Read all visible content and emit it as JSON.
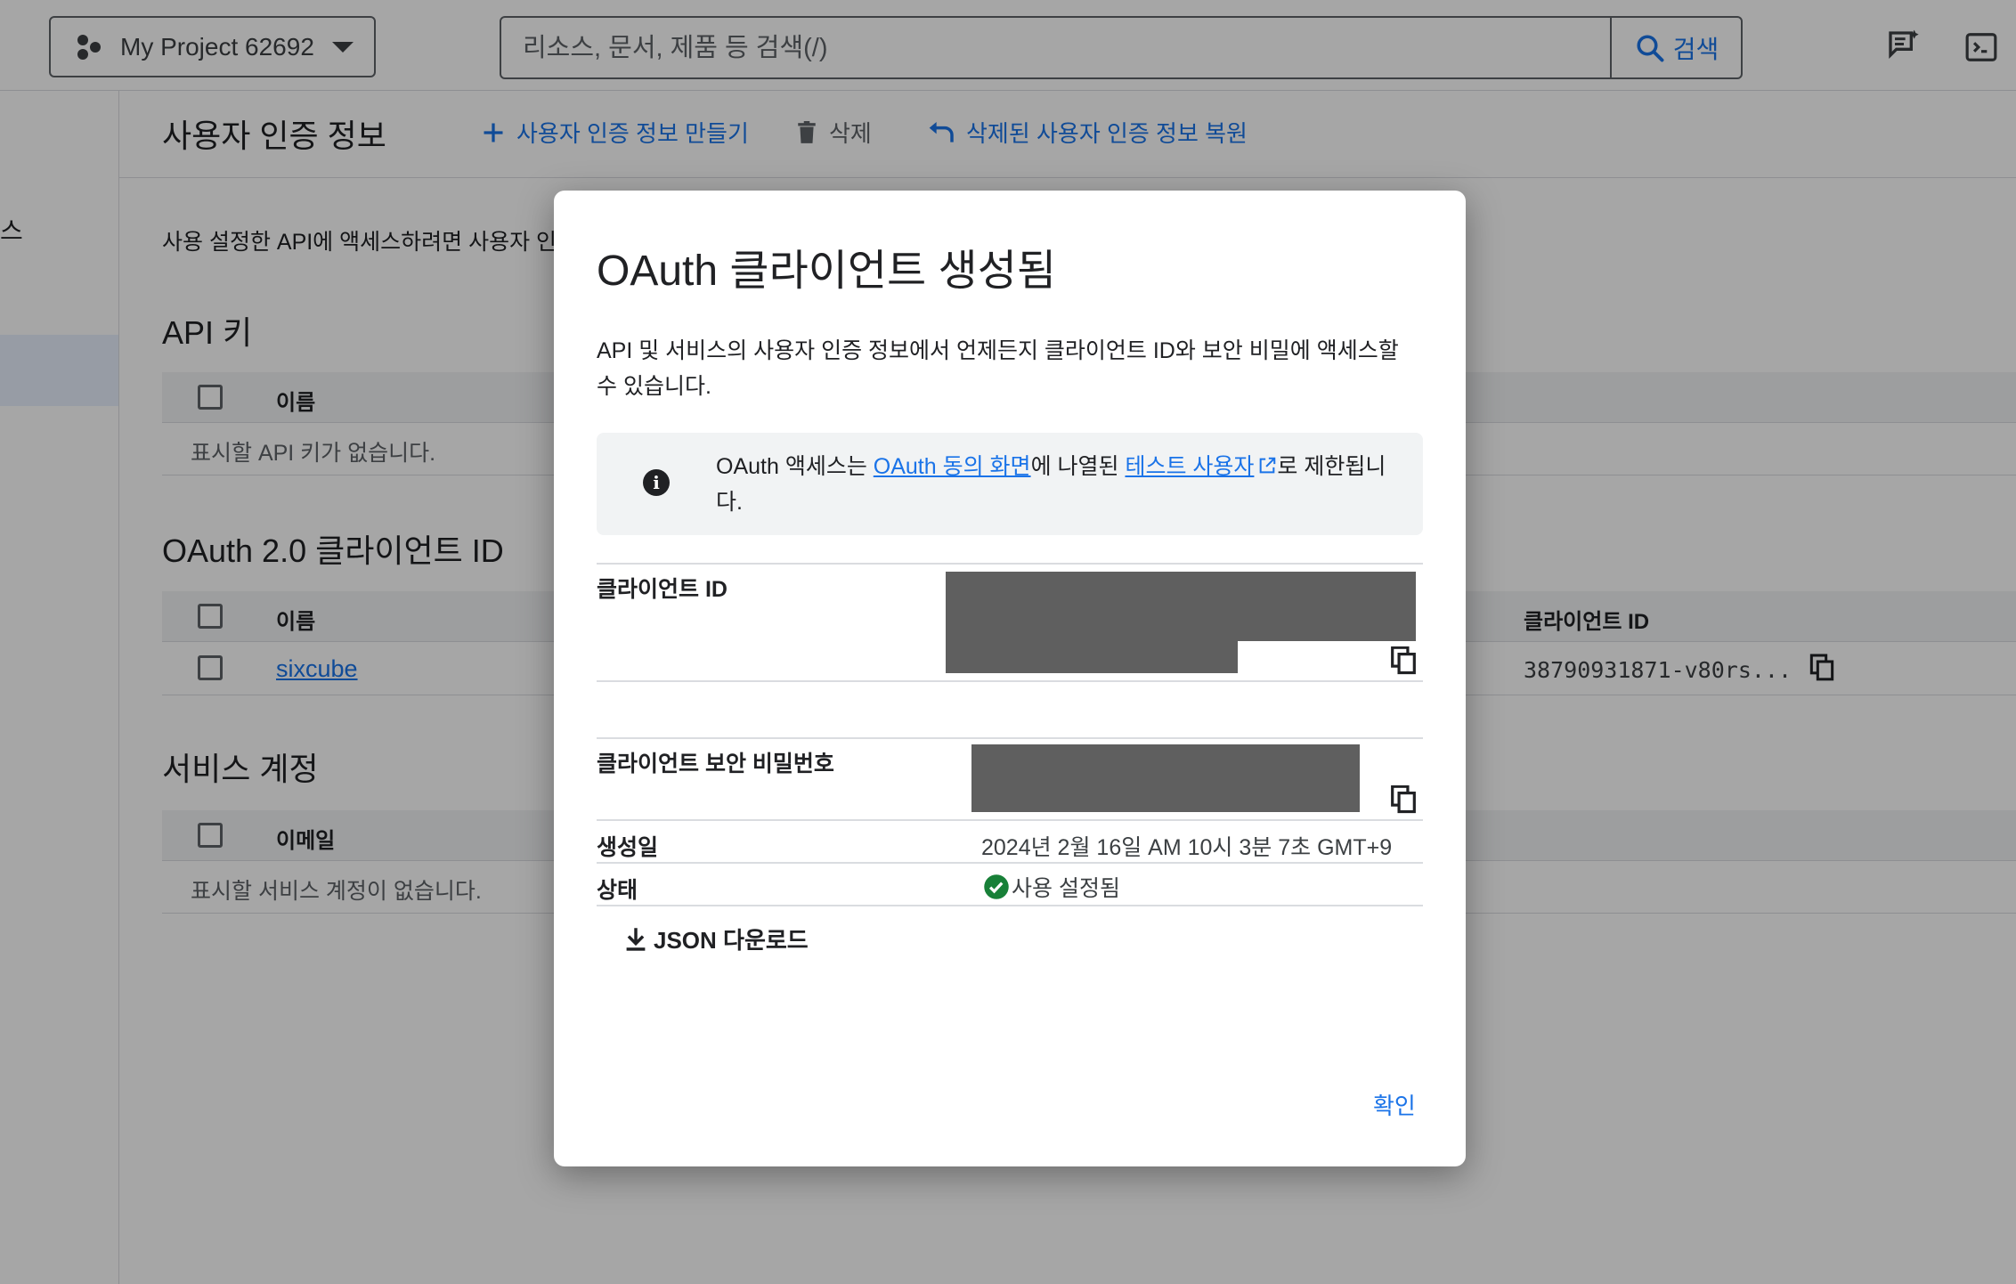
{
  "topbar": {
    "project_name": "My Project 62692",
    "search_placeholder": "리소스, 문서, 제품 등 검색(/)",
    "search_button": "검색"
  },
  "rail": {
    "partial_text": "스"
  },
  "header": {
    "title": "사용자 인증 정보",
    "create_label": "사용자 인증 정보 만들기",
    "delete_label": "삭제",
    "restore_label": "삭제된 사용자 인증 정보 복원"
  },
  "content": {
    "intro": "사용 설정한 API에 액세스하려면 사용자 인증",
    "api_keys": {
      "title": "API 키",
      "col_name": "이름",
      "empty": "표시할 API 키가 없습니다."
    },
    "oauth": {
      "title": "OAuth 2.0 클라이언트 ID",
      "col_name": "이름",
      "col_client_id": "클라이언트 ID",
      "rows": [
        {
          "name": "sixcube",
          "client_id": "38790931871-v80rs..."
        }
      ]
    },
    "service_accounts": {
      "title": "서비스 계정",
      "col_email": "이메일",
      "empty": "표시할 서비스 계정이 없습니다."
    }
  },
  "dialog": {
    "title": "OAuth 클라이언트 생성됨",
    "description": "API 및 서비스의 사용자 인증 정보에서 언제든지 클라이언트 ID와 보안 비밀에 액세스할 수 있습니다.",
    "info": {
      "prefix": "OAuth 액세스는 ",
      "link1": "OAuth 동의 화면",
      "middle": "에 나열된 ",
      "link2": "테스트 사용자",
      "suffix": "로 제한됩니다."
    },
    "client_id_label": "클라이언트 ID",
    "client_secret_label": "클라이언트 보안 비밀번호",
    "created_label": "생성일",
    "created_value": "2024년 2월 16일 AM 10시 3분 7초 GMT+9",
    "status_label": "상태",
    "status_value": "사용 설정됨",
    "json_download": "JSON 다운로드",
    "ok": "확인"
  },
  "colors": {
    "accent": "#1a73e8",
    "status_ok": "#188038"
  }
}
